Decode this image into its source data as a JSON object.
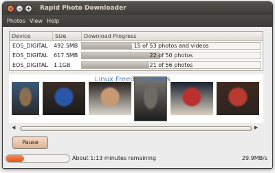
{
  "window": {
    "title": "Rapid Photo Downloader"
  },
  "menu": [
    "Photos",
    "View",
    "Help"
  ],
  "columns": {
    "device": "Device",
    "size": "Size",
    "progress": "Download Progress"
  },
  "devices": [
    {
      "name": "EOS_DIGITAL",
      "size": "492.5MB",
      "progress_text": "15 of 53 photos and videos",
      "progress": 0.28
    },
    {
      "name": "EOS_DIGITAL",
      "size": "617.5MB",
      "progress_text": "22 of 50 photos",
      "progress": 0.44
    },
    {
      "name": "EOS_DIGITAL",
      "size": "1.1GB",
      "progress_text": "21 of 56 photos",
      "progress": 0.375
    }
  ],
  "watermark": "Linux Freedom Lovers",
  "thumbnails": [
    {
      "subject": "child-in-doorway-photo",
      "colors": [
        "#3c5a78",
        "#8a7050",
        "#2a2a2a"
      ]
    },
    {
      "subject": "child-in-blue-shirt-photo",
      "colors": [
        "#3a2f28",
        "#2a56a8",
        "#1a1a1a"
      ]
    },
    {
      "subject": "elderly-man-portrait-photo",
      "colors": [
        "#2a2420",
        "#c89a74",
        "#d8d4cc"
      ]
    },
    {
      "subject": "man-in-dark-room-photo",
      "colors": [
        "#7d7a74",
        "#6e6a64",
        "#1d1d1d"
      ]
    },
    {
      "subject": "group-of-people-night-photo",
      "colors": [
        "#1c2230",
        "#b83030",
        "#d8d0c0"
      ]
    },
    {
      "subject": "crowd-in-red-photo",
      "colors": [
        "#402a20",
        "#b83a32",
        "#2a2420"
      ]
    }
  ],
  "pause_label": "Pause",
  "status": {
    "time_remaining": "About 1:13 minutes remaining",
    "speed": "29.9MB/s",
    "overall_progress": 0.28
  },
  "colors": {
    "accent": "#e05414",
    "titlebar": "#3c3b37"
  }
}
